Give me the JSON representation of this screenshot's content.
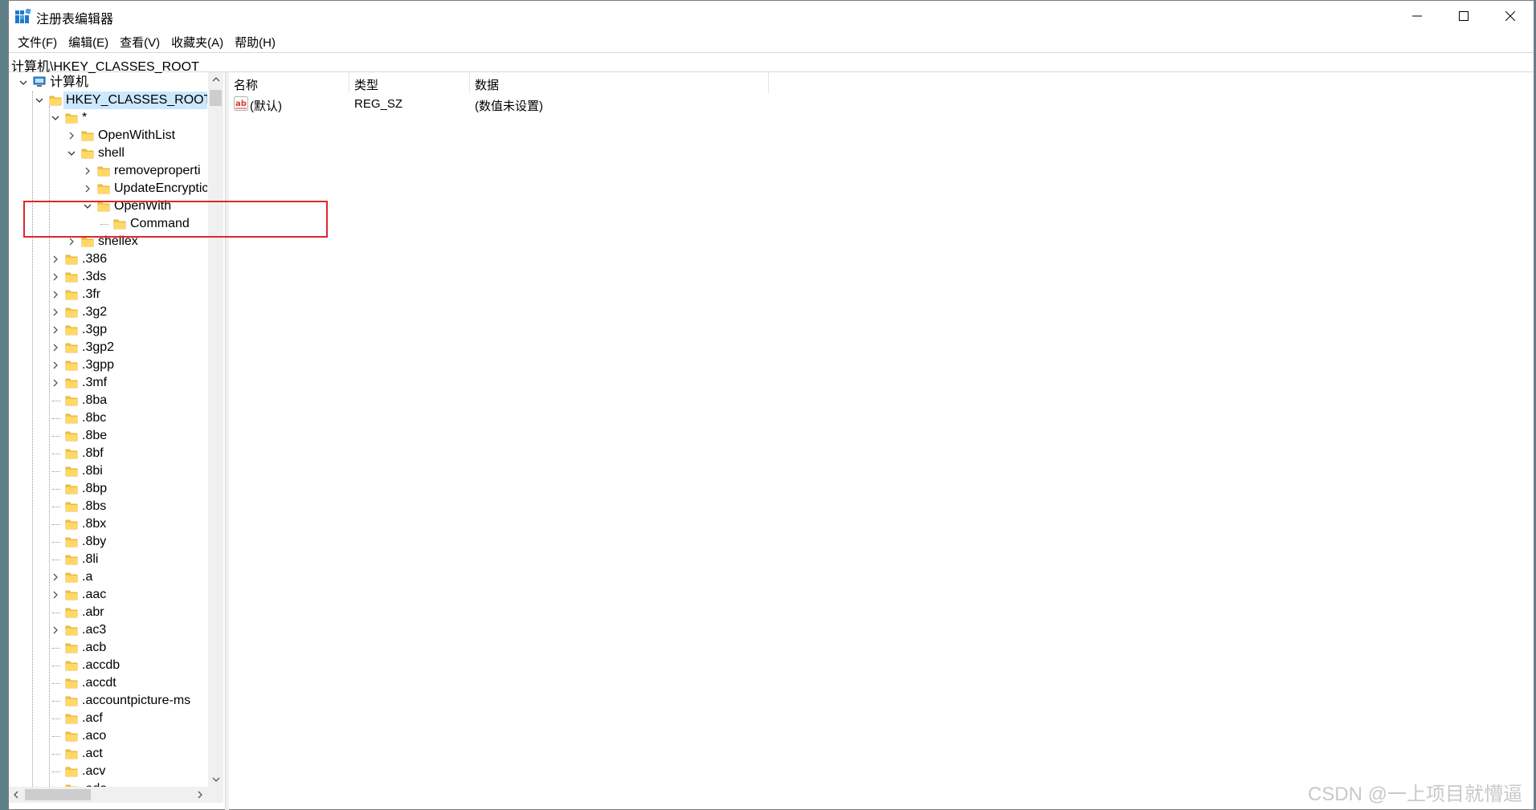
{
  "window": {
    "title": "注册表编辑器"
  },
  "menu": [
    {
      "id": "file",
      "label": "文件(F)"
    },
    {
      "id": "edit",
      "label": "编辑(E)"
    },
    {
      "id": "view",
      "label": "查看(V)"
    },
    {
      "id": "favorites",
      "label": "收藏夹(A)"
    },
    {
      "id": "help",
      "label": "帮助(H)"
    }
  ],
  "address": "计算机\\HKEY_CLASSES_ROOT",
  "tree": {
    "root": "计算机",
    "hive": "HKEY_CLASSES_ROOT",
    "star": "*",
    "openwithlist": "OpenWithList",
    "shell": "shell",
    "removeproperties": "removeproperti",
    "updateencryption": "UpdateEncryptic",
    "openwith": "OpenWith",
    "command": "Command",
    "shellex": "shellex",
    "extensions": [
      ".386",
      ".3ds",
      ".3fr",
      ".3g2",
      ".3gp",
      ".3gp2",
      ".3gpp",
      ".3mf",
      ".8ba",
      ".8bc",
      ".8be",
      ".8bf",
      ".8bi",
      ".8bp",
      ".8bs",
      ".8bx",
      ".8by",
      ".8li",
      ".a",
      ".aac",
      ".abr",
      ".ac3",
      ".acb",
      ".accdb",
      ".accdt",
      ".accountpicture-ms",
      ".acf",
      ".aco",
      ".act",
      ".acv",
      ".ado"
    ],
    "extensions_expandable": [
      true,
      true,
      true,
      true,
      true,
      true,
      true,
      true,
      false,
      false,
      false,
      false,
      false,
      false,
      false,
      false,
      false,
      false,
      true,
      true,
      false,
      true,
      false,
      false,
      false,
      false,
      false,
      false,
      false,
      false,
      false
    ]
  },
  "columns": {
    "name": "名称",
    "type": "类型",
    "data": "数据"
  },
  "values": [
    {
      "name": "(默认)",
      "type": "REG_SZ",
      "data": "(数值未设置)",
      "icon": "ab-string-icon"
    }
  ],
  "watermark": "CSDN @一上项目就懵逼",
  "colors": {
    "highlight_border": "#e0262e",
    "selection": "#cce8ff",
    "folder": "#f4c542"
  }
}
